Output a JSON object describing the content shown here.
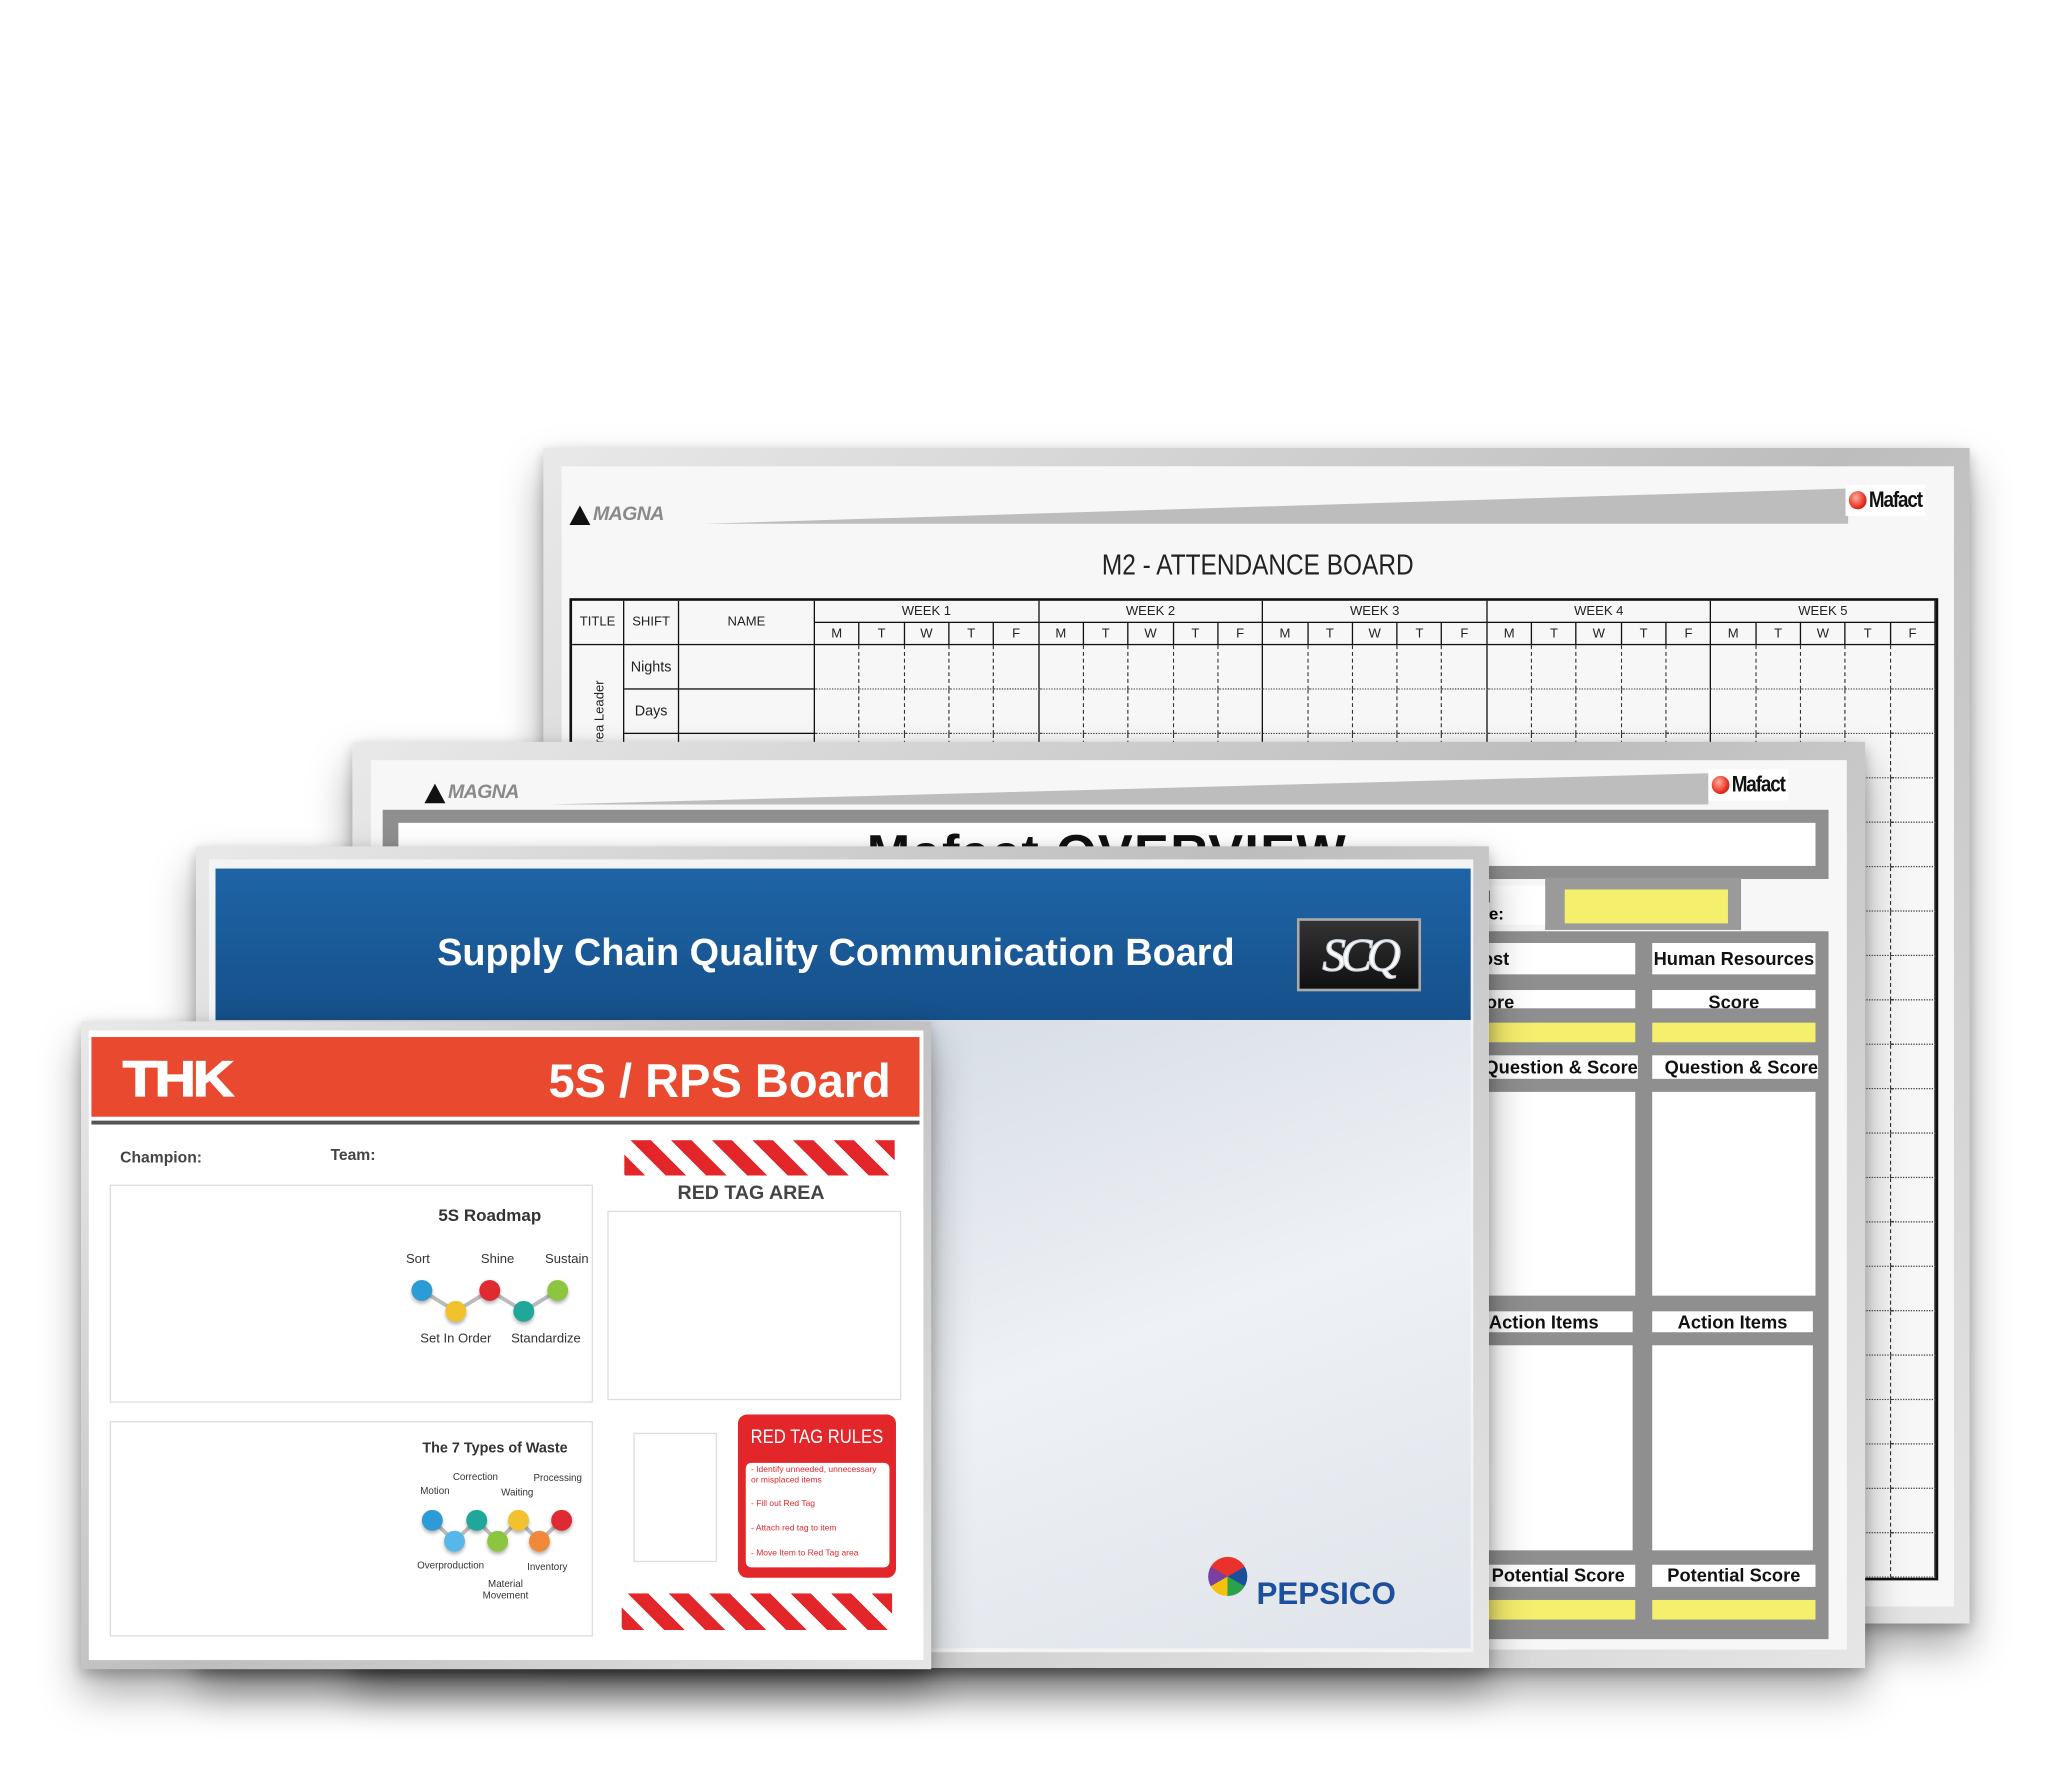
{
  "attendance_board": {
    "logo_left": "MAGNA",
    "logo_right": "Mafact",
    "title": "M2 - ATTENDANCE BOARD",
    "headers": {
      "title": "TITLE",
      "shift": "SHIFT",
      "name": "NAME"
    },
    "weeks": [
      "WEEK 1",
      "WEEK 2",
      "WEEK 3",
      "WEEK 4",
      "WEEK 5"
    ],
    "days": [
      "M",
      "T",
      "W",
      "T",
      "F"
    ],
    "row_group_label": "Area Leader",
    "shifts": [
      "Nights",
      "Days"
    ]
  },
  "overview_board": {
    "logo_left": "MAGNA",
    "logo_right": "Mafact",
    "title": "Mafact OVERVIEW",
    "final_score_label": "Final Score:",
    "columns": [
      {
        "name": "Cost",
        "score": "Score",
        "question": "Question & Score",
        "action": "Action Items",
        "potential": "Potential Score"
      },
      {
        "name": "Human Resources",
        "score": "Score",
        "question": "Question & Score",
        "action": "Action Items",
        "potential": "Potential Score"
      }
    ],
    "colors": {
      "score_fill": "#f5ef6e",
      "frame": "#8f8f8f"
    }
  },
  "scq_board": {
    "title": "Supply Chain Quality Communication Board",
    "logo": "SCQ",
    "sponsor_logo": "PEPSICO",
    "colors": {
      "header": "#1a5a96"
    }
  },
  "rps_board": {
    "logo": "THK",
    "title": "5S / RPS Board",
    "champion_label": "Champion:",
    "team_label": "Team:",
    "roadmap": {
      "title": "5S Roadmap",
      "steps": [
        "Sort",
        "Set In Order",
        "Shine",
        "Standardize",
        "Sustain"
      ]
    },
    "waste": {
      "title": "The 7 Types of Waste",
      "types": [
        "Motion",
        "Correction",
        "Waiting",
        "Processing",
        "Overproduction",
        "Material Movement",
        "Inventory"
      ]
    },
    "red_tag_area": "RED TAG AREA",
    "red_tag_rules": {
      "title": "RED TAG RULES",
      "items": [
        "- Identify unneeded, unnecessary or misplaced items",
        "- Fill out Red Tag",
        "- Attach red tag to item",
        "- Move Item to Red Tag area"
      ]
    },
    "colors": {
      "header": "#e8492f",
      "red": "#e3262a"
    }
  }
}
